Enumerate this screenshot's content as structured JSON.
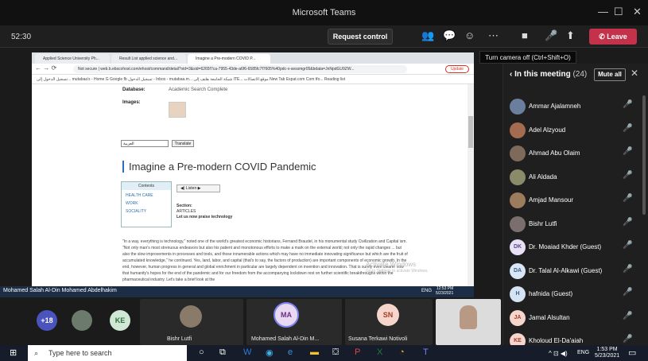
{
  "teams": {
    "window_title": "Microsoft Teams",
    "timer": "52:30",
    "request_control": "Request control",
    "leave_label": "Leave",
    "tooltip": "Turn camera off (Ctrl+Shift+O)"
  },
  "browser": {
    "tabs": [
      "Applied Science University Ph...",
      "Result List applied science and...",
      "Imagine a Pre-modern COVID P..."
    ],
    "url": "Not secure | web.b.ebscohost.com/ehost/command/detail?vid=3&sid=6265f7ca-7955-43de-a6f6-6585fc7f7605%40pdc-v-sessmgr05&bdata=JnNpdGU9ZW...",
    "update_label": "Update",
    "bookmarks": "تسجيل الدخول إلى...  mutabaa's - Home  G Google  fb  تسجيل الدخول - Inbox - mutabaa.m...  شبكة الجامعة  هلتف إلى ITE...  موقع الاتصالات  New Tab  Expat.com Com tfo...  Reading list"
  },
  "article": {
    "database_label": "Database:",
    "database_value": "Academic Search Complete",
    "images_label": "Images:",
    "lang_select": "العربية",
    "translate_button": "Translate",
    "title": "Imagine a Pre-modern COVID Pandemic",
    "contents_header": "Contents",
    "contents_items": [
      "HEALTH CARE",
      "WORK",
      "SOCIALITY"
    ],
    "listen_button": "Listen",
    "section_label": "Section:",
    "section_value": "ARTICLES",
    "section_sub": "Let us now praise technology",
    "paragraph": "\"In a way, everything is technology,\" noted one of the world's greatest economic historians, Fernand Braudel, in his monumental study Civilization and Capital ism. \"Not only man's most strenuous endeavors but also his patient and monotonous efforts to make a mark on the external world; not only the rapid changes ... but also the slow improvements in processes and tools, and those innumerable actions which may have no immediate innovating significance but which are the fruit of accumulated knowledge,\" he continued. Yes, land, labor, and capital (that's to say, the factors of production) are important components of economic growth. In the end, however, human progress in general and global enrichment in particular are largely dependent on invention and innovation. That is surely even clearer now that humanity's hopes for the end of the pandemic and for our freedom from the accompanying lockdown rest on further scientific breakthroughs within the pharmaceutical industry. Let's take a brief look at the",
    "watermark": "Activate Windows",
    "watermark_sub": "Go to Settings to activate Windows."
  },
  "share": {
    "presenter": "Mohamed Salah Al-Din Mohamed Abdelhakim",
    "lang": "ENG",
    "time": "12:53 PM",
    "date": "5/23/2021"
  },
  "strip": {
    "more": "+18",
    "ke": "KE",
    "bishr": "Bishr Lutfi",
    "ma": "MA",
    "ma_name": "Mohamed Salah Al-Din M...",
    "sn": "SN",
    "sn_name": "Susana Terkawi Notivoli"
  },
  "panel": {
    "header": "In this meeting",
    "count": "(24)",
    "mute_all": "Mute all",
    "participants": [
      {
        "name": "Ammar Ajalamneh",
        "initials": ""
      },
      {
        "name": "Adel Alzyoud",
        "initials": ""
      },
      {
        "name": "Ahmad Abu Olaim",
        "initials": ""
      },
      {
        "name": "Ali Aldada",
        "initials": ""
      },
      {
        "name": "Amjad Mansour",
        "initials": ""
      },
      {
        "name": "Bishr Lutfi",
        "initials": ""
      },
      {
        "name": "Dr. Moaiad Khder (Guest)",
        "initials": "DK"
      },
      {
        "name": "Dr. Talal Al-Alkawi (Guest)",
        "initials": "DA"
      },
      {
        "name": "hafnida (Guest)",
        "initials": "H"
      },
      {
        "name": "Jamal Alsultan",
        "initials": "JA"
      },
      {
        "name": "Kholoud El-Da'aiah",
        "initials": "KE"
      }
    ]
  },
  "taskbar": {
    "search_placeholder": "Type here to search",
    "lang": "ENG",
    "time": "1:53 PM",
    "date": "5/23/2021"
  },
  "colors": {
    "leave": "#c4314b",
    "link": "#2c6fb7"
  }
}
